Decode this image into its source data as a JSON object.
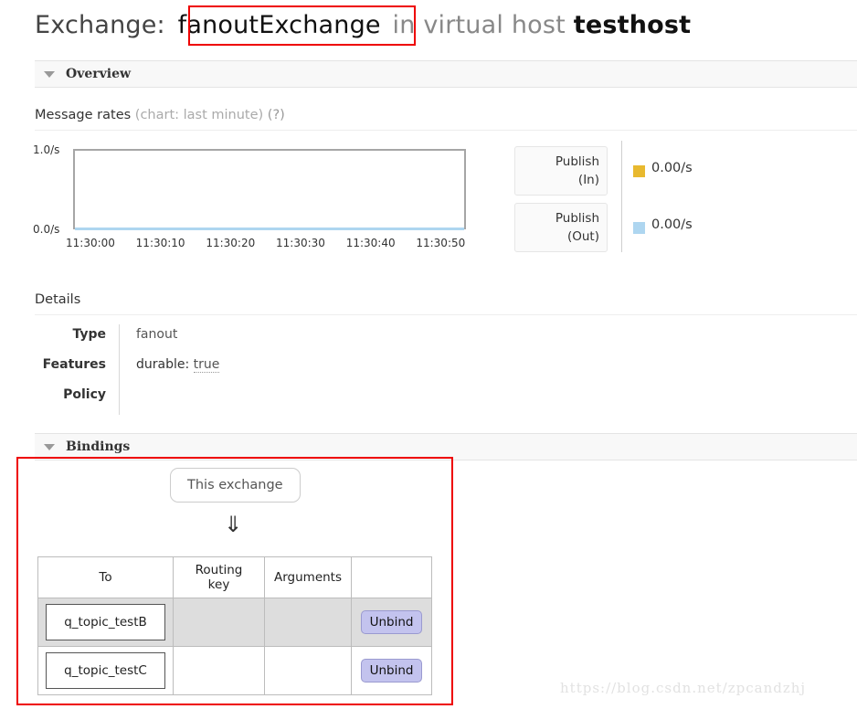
{
  "title": {
    "prefix": "Exchange:",
    "exchange_name": "fanoutExchange",
    "middle": "in virtual host",
    "vhost_name": "testhost"
  },
  "sections": {
    "overview": {
      "label": "Overview",
      "toggle_icon": "triangle-down-icon"
    },
    "bindings": {
      "label": "Bindings",
      "toggle_icon": "triangle-down-icon"
    }
  },
  "message_rates": {
    "heading": "Message rates",
    "heading_note": "(chart: last minute)",
    "help": "(?)"
  },
  "chart_data": {
    "type": "line",
    "title": "Message rates (chart: last minute)",
    "xlabel": "",
    "ylabel": "",
    "ylim": [
      0.0,
      1.0
    ],
    "y_ticks": [
      "0.0/s",
      "1.0/s"
    ],
    "x": [
      "11:30:00",
      "11:30:10",
      "11:30:20",
      "11:30:30",
      "11:30:40",
      "11:30:50"
    ],
    "grid": false,
    "legend_position": "right",
    "series": [
      {
        "name": "Publish (In)",
        "color": "#e8b92f",
        "current_value": "0.00/s",
        "values": [
          0.0,
          0.0,
          0.0,
          0.0,
          0.0,
          0.0
        ]
      },
      {
        "name": "Publish (Out)",
        "color": "#aed6f0",
        "current_value": "0.00/s",
        "values": [
          0.0,
          0.0,
          0.0,
          0.0,
          0.0,
          0.0
        ]
      }
    ]
  },
  "legend": {
    "publish_in": {
      "button_line1": "Publish",
      "button_line2": "(In)",
      "value": "0.00/s",
      "color": "#e8b92f"
    },
    "publish_out": {
      "button_line1": "Publish",
      "button_line2": "(Out)",
      "value": "0.00/s",
      "color": "#aed6f0"
    }
  },
  "details": {
    "heading": "Details",
    "rows": [
      {
        "key": "Type",
        "value": "fanout"
      },
      {
        "key": "Features",
        "feature_label": "durable:",
        "feature_value": "true"
      },
      {
        "key": "Policy",
        "value": ""
      }
    ]
  },
  "bindings": {
    "source_box_label": "This exchange",
    "arrow_glyph": "⇓",
    "columns": [
      "To",
      "Routing key",
      "Arguments",
      ""
    ],
    "rows": [
      {
        "to": "q_topic_testB",
        "routing_key": "",
        "arguments": "",
        "action": "Unbind"
      },
      {
        "to": "q_topic_testC",
        "routing_key": "",
        "arguments": "",
        "action": "Unbind"
      }
    ]
  },
  "watermark": {
    "text": "https://blog.csdn.net/zpcandzhj"
  },
  "annotations": {
    "color": "#ee0000",
    "boxes": [
      "exchange-name-highlight",
      "bindings-highlight"
    ]
  }
}
